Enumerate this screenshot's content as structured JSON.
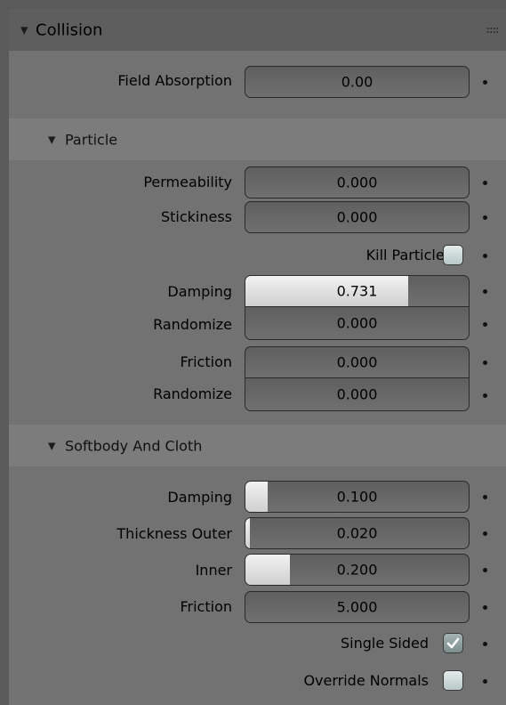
{
  "panel": {
    "title": "Collision",
    "field_absorption": {
      "label": "Field Absorption",
      "value": "0.00"
    }
  },
  "particle": {
    "title": "Particle",
    "permeability": {
      "label": "Permeability",
      "value": "0.000"
    },
    "stickiness": {
      "label": "Stickiness",
      "value": "0.000"
    },
    "kill_particles": {
      "label": "Kill Particles",
      "checked": false
    },
    "damping": {
      "label": "Damping",
      "value": "0.731",
      "fill_fraction": 0.731
    },
    "damping_randomize": {
      "label": "Randomize",
      "value": "0.000"
    },
    "friction": {
      "label": "Friction",
      "value": "0.000"
    },
    "friction_randomize": {
      "label": "Randomize",
      "value": "0.000"
    }
  },
  "softbody": {
    "title": "Softbody And Cloth",
    "damping": {
      "label": "Damping",
      "value": "0.100",
      "fill_fraction": 0.1
    },
    "thickness_outer": {
      "label": "Thickness Outer",
      "value": "0.020",
      "fill_fraction": 0.02
    },
    "inner": {
      "label": "Inner",
      "value": "0.200",
      "fill_fraction": 0.2
    },
    "friction": {
      "label": "Friction",
      "value": "5.000"
    },
    "single_sided": {
      "label": "Single Sided",
      "checked": true
    },
    "override_normals": {
      "label": "Override Normals",
      "checked": false
    }
  },
  "icons": {
    "collapse": "triangle-down-icon",
    "grip": "drag-grip-icon",
    "keyframe": "keyframe-dot-icon",
    "check": "checkmark-icon"
  },
  "colors": {
    "background": "#727272",
    "header": "#5e5e5e",
    "subheader": "#7c7c7c",
    "field": "#676767",
    "slider_fill": "#e6e6e6"
  }
}
